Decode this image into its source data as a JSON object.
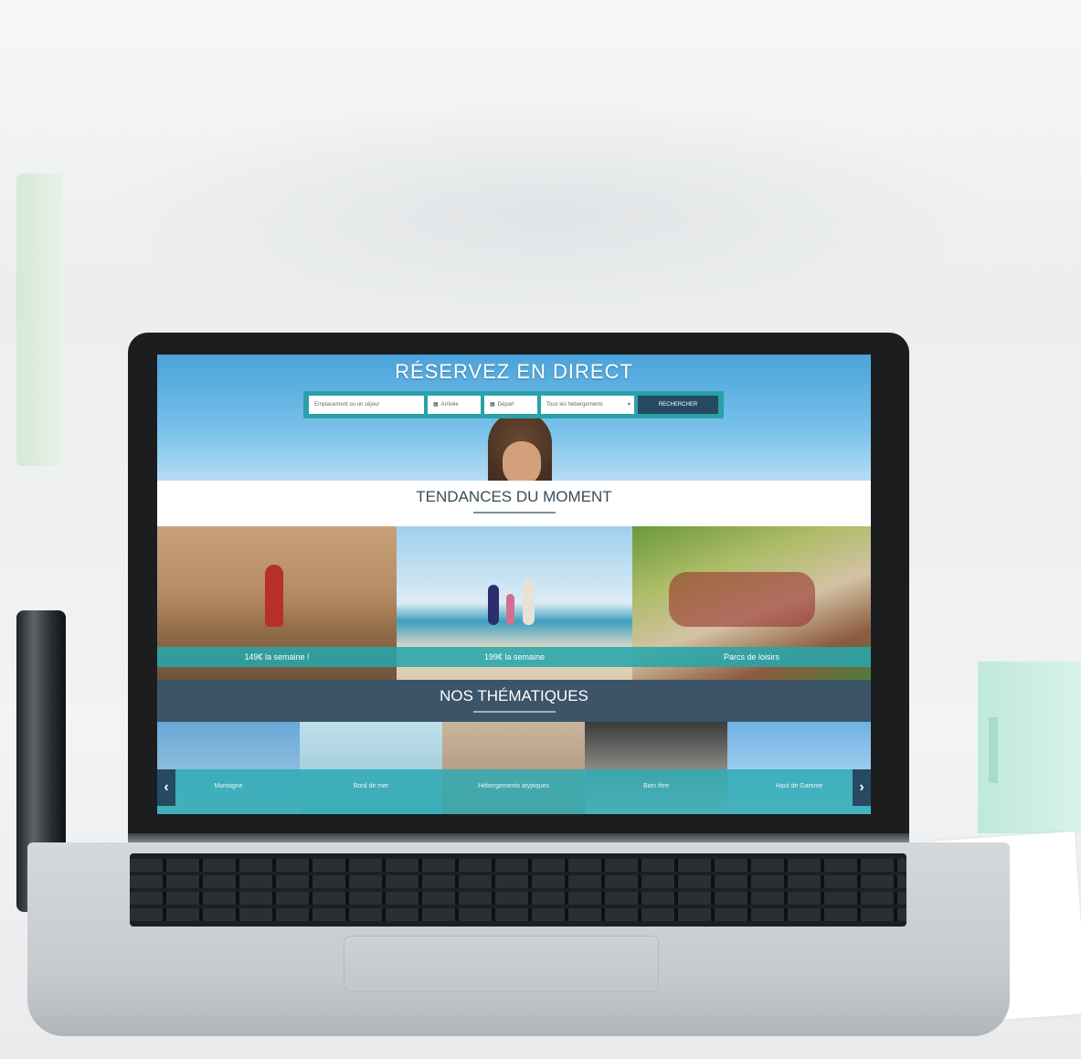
{
  "hero": {
    "title": "RÉSERVEZ EN DIRECT",
    "search": {
      "location_placeholder": "Emplacement ou un séjour",
      "arrival_placeholder": "Arrivée",
      "departure_placeholder": "Départ",
      "type_value": "Tous les hébergements",
      "button_label": "RECHERCHER"
    }
  },
  "trends": {
    "title": "TENDANCES DU MOMENT",
    "cards": [
      {
        "caption": "149€ la semaine !"
      },
      {
        "caption": "199€ la semaine"
      },
      {
        "caption": "Parcs de loisirs"
      }
    ]
  },
  "themes": {
    "title": "NOS THÉMATIQUES",
    "items": [
      {
        "label": "Montagne"
      },
      {
        "label": "Bord de mer"
      },
      {
        "label": "Hébergements atypiques"
      },
      {
        "label": "Bien être"
      },
      {
        "label": "Haut de Gamme"
      }
    ],
    "prev_icon": "chevron-left-icon",
    "next_icon": "chevron-right-icon"
  },
  "colors": {
    "accent_teal": "#2aa1a9",
    "dark_blue": "#274a63",
    "section_blue": "#3c5468"
  }
}
